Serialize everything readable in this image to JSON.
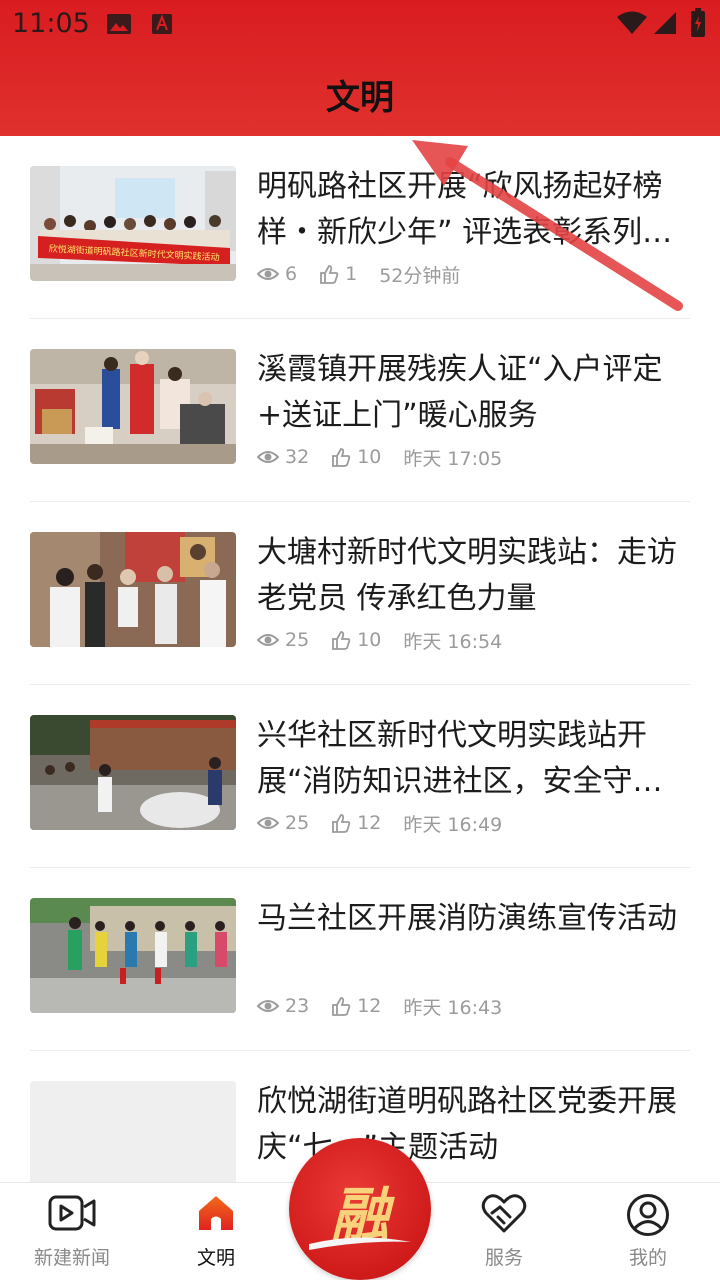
{
  "status_bar": {
    "time": "11:05"
  },
  "header": {
    "title": "文明"
  },
  "colors": {
    "header_red": "#d91c20",
    "accent": "#e0312e",
    "meta_gray": "#9b9b9b"
  },
  "articles": [
    {
      "title": "明矾路社区开展“欣风扬起好榜样・新欣少年” 评选表彰系列…",
      "views": "6",
      "likes": "1",
      "time": "52分钟前",
      "banner_text": "欣悦湖街道明矾路社区新时代文明实践活动"
    },
    {
      "title": "溪霞镇开展残疾人证“入户评定+送证上门”暖心服务",
      "views": "32",
      "likes": "10",
      "time": "昨天 17:05"
    },
    {
      "title": "大塘村新时代文明实践站：走访老党员  传承红色力量",
      "views": "25",
      "likes": "10",
      "time": "昨天 16:54"
    },
    {
      "title": "兴华社区新时代文明实践站开展“消防知识进社区，安全守…",
      "views": "25",
      "likes": "12",
      "time": "昨天 16:49"
    },
    {
      "title": "马兰社区开展消防演练宣传活动",
      "views": "23",
      "likes": "12",
      "time": "昨天 16:43"
    },
    {
      "title": "欣悦湖街道明矾路社区党委开展庆“七一”主题活动",
      "views": "",
      "likes": "",
      "time": ""
    }
  ],
  "bottom_nav": {
    "tabs": [
      {
        "label": "新建新闻",
        "icon": "video-icon"
      },
      {
        "label": "文明",
        "icon": "home-icon"
      },
      {
        "label": "",
        "icon": "rong-logo"
      },
      {
        "label": "服务",
        "icon": "heart-hands-icon"
      },
      {
        "label": "我的",
        "icon": "user-icon"
      }
    ],
    "center_glyph": "融"
  }
}
